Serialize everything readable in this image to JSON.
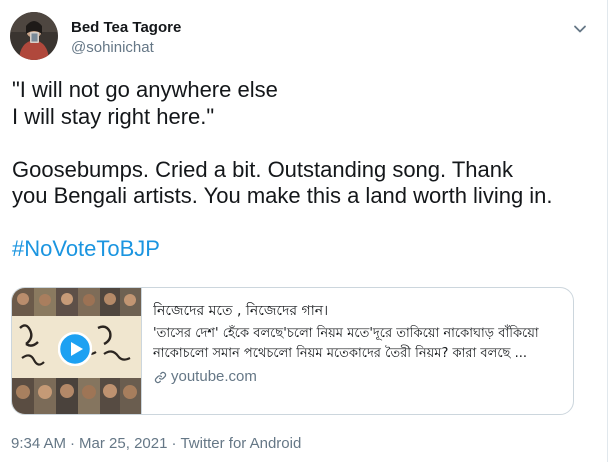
{
  "author": {
    "display_name": "Bed Tea Tagore",
    "handle": "@sohinichat"
  },
  "tweet": {
    "line1": "\"I will not go anywhere else",
    "line2": "I will stay right here.\"",
    "line3": "Goosebumps. Cried a bit. Outstanding song. Thank",
    "line4": "you Bengali artists. You make this a land worth living in.",
    "hashtag": "#NoVoteToBJP"
  },
  "card": {
    "title": "নিজেদের মতে , নিজেদের গান।",
    "description": "'তাসের দেশ' হেঁকে বলছে'চলো নিয়ম মতে'দূরে তাকিয়ো নাকোঘাড় বাঁকিয়ো নাকোচলো সমান পথেচলো নিয়ম মতেকাদের তৈরী নিয়ম? কারা বলছে ...",
    "domain": "youtube.com",
    "thumbnail_icon": "video-thumbnail-collage"
  },
  "meta": {
    "time": "9:34 AM",
    "separator1": "·",
    "date": "Mar 25, 2021",
    "separator2": "·",
    "source": "Twitter for Android"
  },
  "colors": {
    "link_blue": "#1b95e0",
    "text_dark": "#14171a",
    "text_muted": "#657786",
    "border": "#ccd6dd"
  }
}
